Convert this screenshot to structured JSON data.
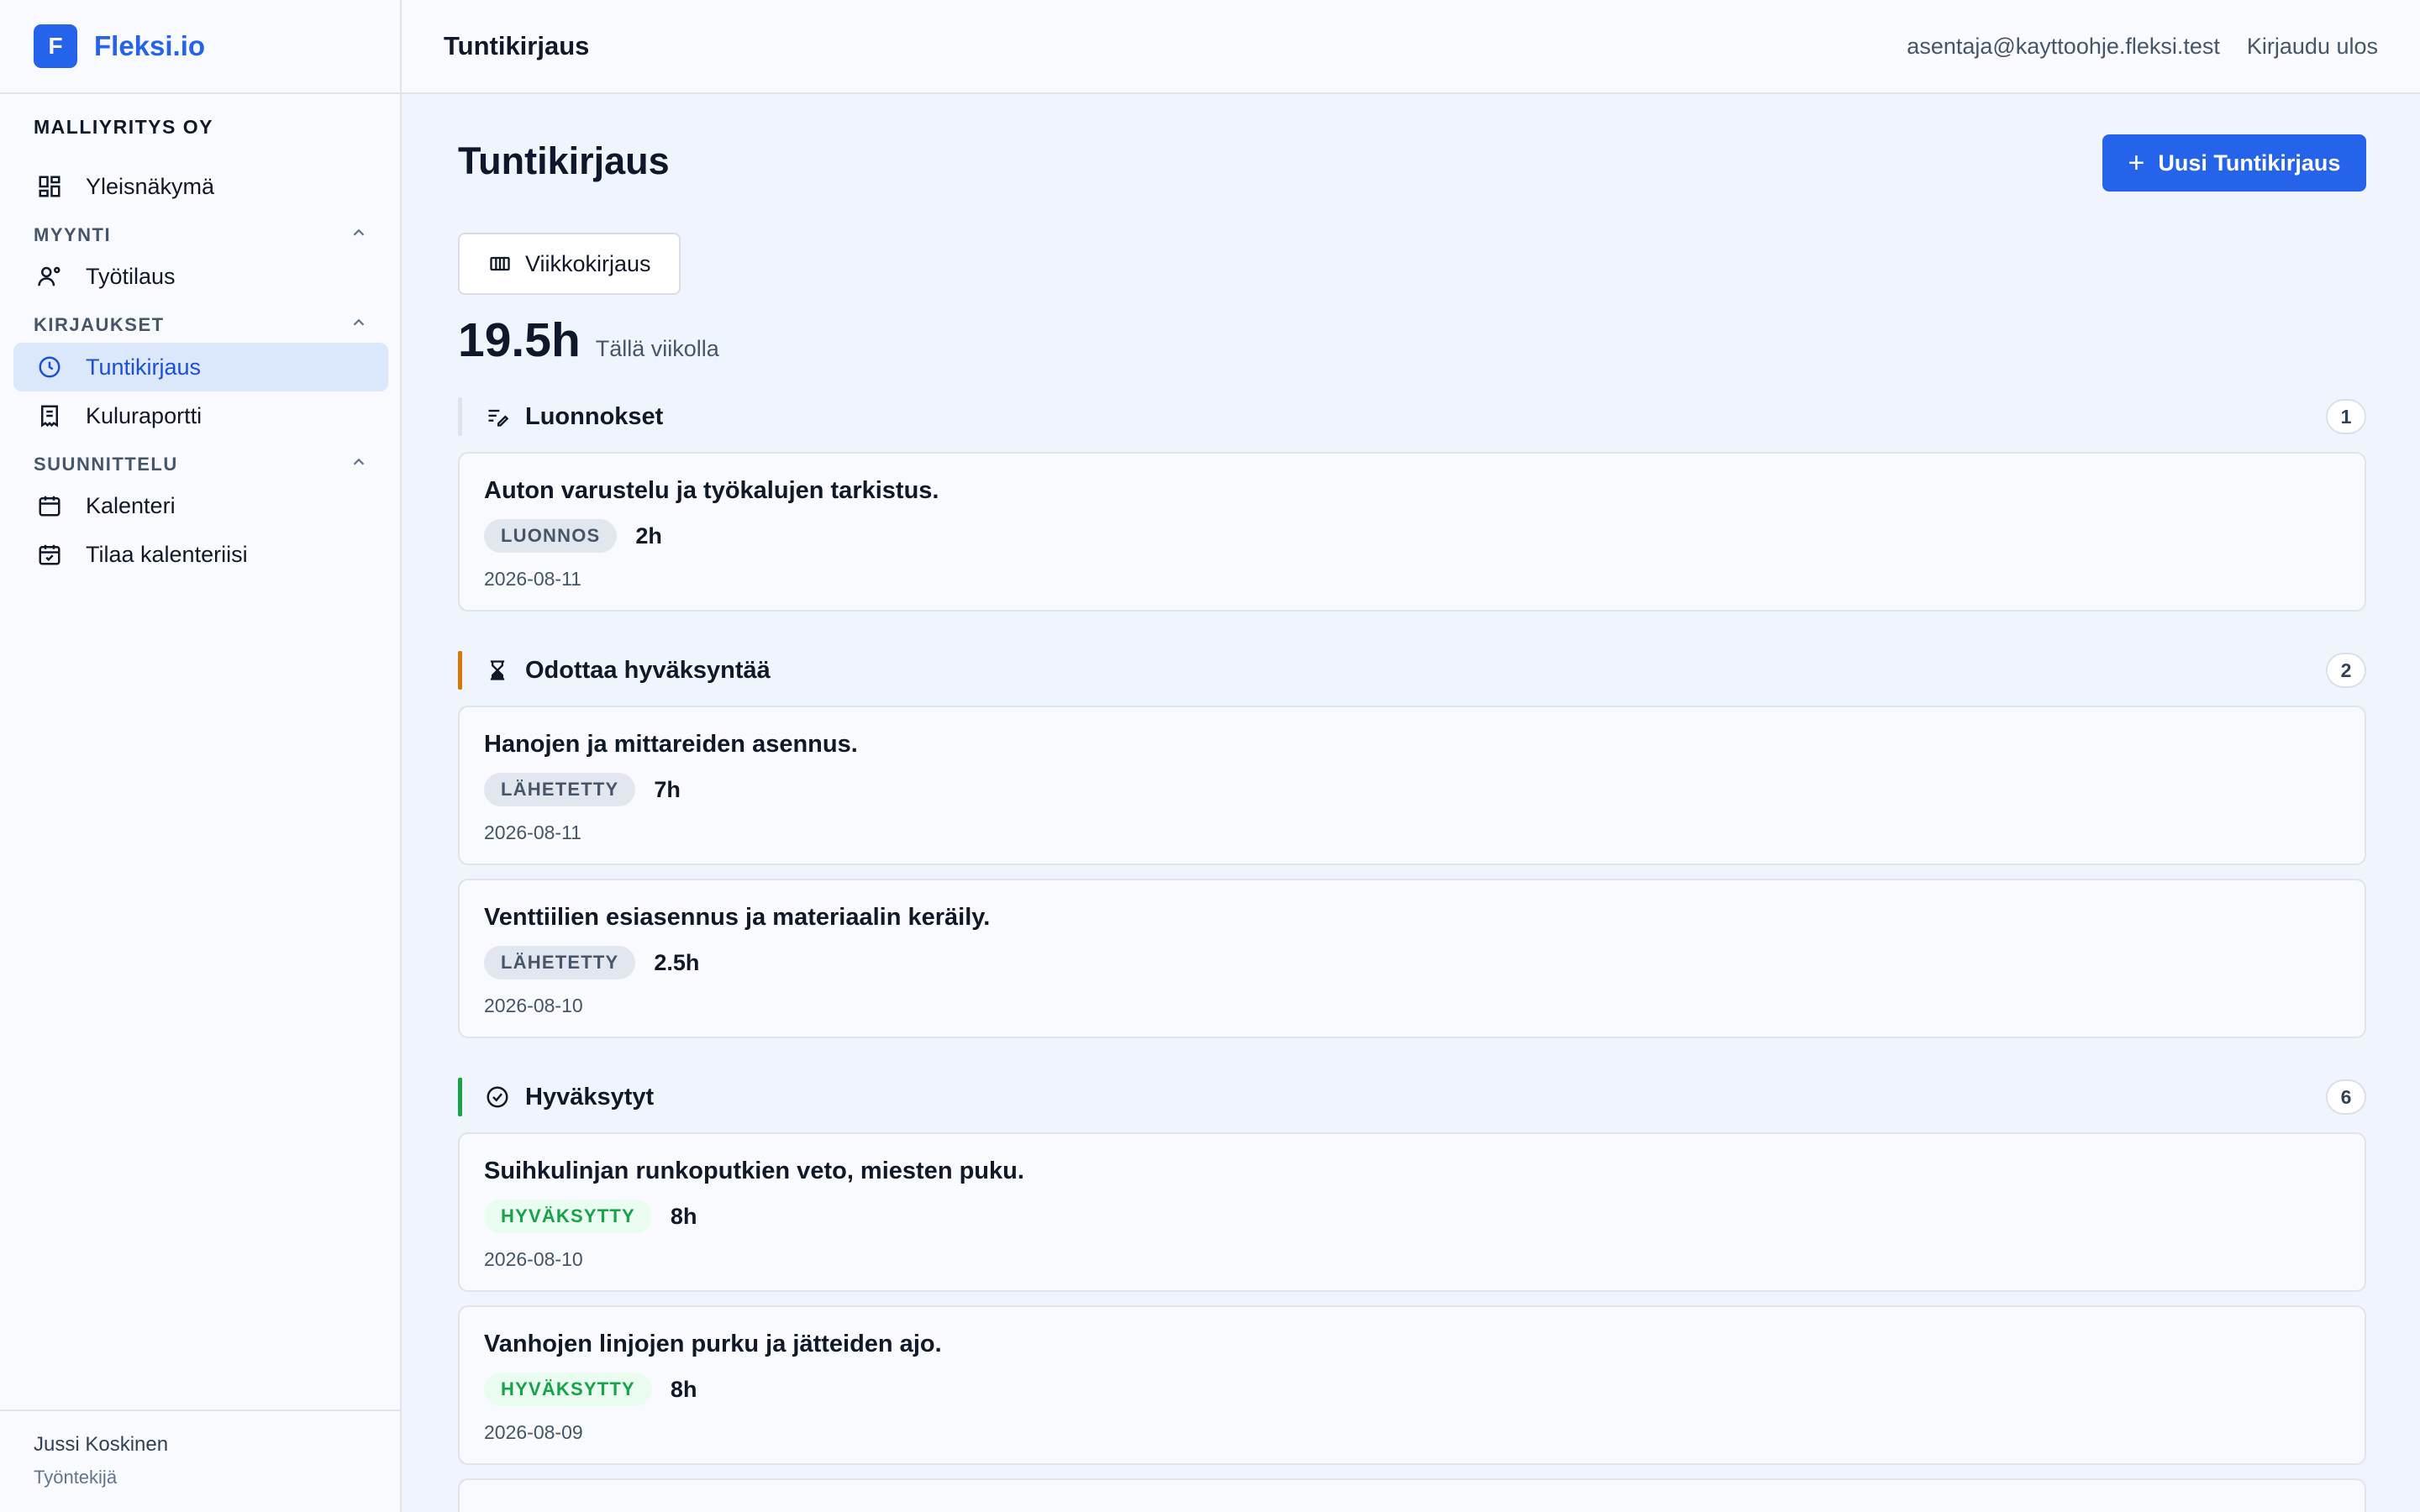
{
  "brand": {
    "logo_letter": "F",
    "name": "Fleksi.io",
    "color": "#2563eb"
  },
  "sidebar": {
    "company": "MALLIYRITYS OY",
    "overview": "Yleisnäkymä",
    "sections": [
      {
        "label": "MYYNTI",
        "items": [
          "Työtilaus"
        ]
      },
      {
        "label": "KIRJAUKSET",
        "items": [
          "Tuntikirjaus",
          "Kuluraportti"
        ]
      },
      {
        "label": "SUUNNITTELU",
        "items": [
          "Kalenteri",
          "Tilaa kalenteriisi"
        ]
      }
    ],
    "active_item": "Tuntikirjaus",
    "user": {
      "name": "Jussi Koskinen",
      "role": "Työntekijä"
    }
  },
  "header": {
    "title": "Tuntikirjaus",
    "email": "asentaja@kayttoohje.fleksi.test",
    "logout": "Kirjaudu ulos"
  },
  "main": {
    "title": "Tuntikirjaus",
    "new_button": "Uusi Tuntikirjaus",
    "week_button": "Viikkokirjaus",
    "week_hours": "19.5h",
    "week_label": "Tällä viikolla",
    "groups": [
      {
        "title": "Luonnokset",
        "count": "1",
        "bar_color": "#dfe3ea",
        "icon": "draft-icon",
        "entries": [
          {
            "title": "Auton varustelu ja työkalujen tarkistus.",
            "status": "LUONNOS",
            "hours": "2h",
            "date": "2026-08-11"
          }
        ]
      },
      {
        "title": "Odottaa hyväksyntää",
        "count": "2",
        "bar_color": "#d97706",
        "icon": "hourglass-icon",
        "entries": [
          {
            "title": "Hanojen ja mittareiden asennus.",
            "status": "LÄHETETTY",
            "hours": "7h",
            "date": "2026-08-11"
          },
          {
            "title": "Venttiilien esiasennus ja materiaalin keräily.",
            "status": "LÄHETETTY",
            "hours": "2.5h",
            "date": "2026-08-10"
          }
        ]
      },
      {
        "title": "Hyväksytyt",
        "count": "6",
        "bar_color": "#16a34a",
        "icon": "check-circle-icon",
        "entries": [
          {
            "title": "Suihkulinjan runkoputkien veto, miesten puku.",
            "status": "HYVÄKSYTTY",
            "hours": "8h",
            "date": "2026-08-10"
          },
          {
            "title": "Vanhojen linjojen purku ja jätteiden ajo.",
            "status": "HYVÄKSYTTY",
            "hours": "8h",
            "date": "2026-08-09"
          }
        ]
      }
    ]
  }
}
